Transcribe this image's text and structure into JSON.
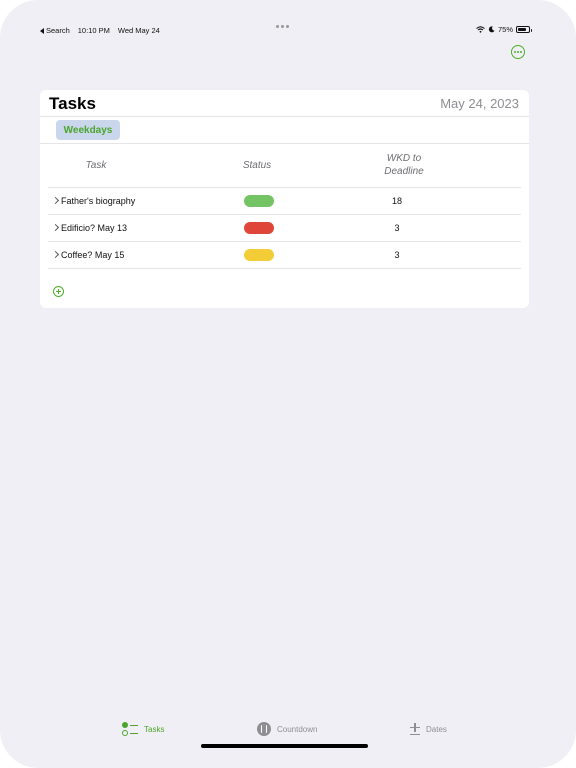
{
  "status_bar": {
    "back_label": "Search",
    "time": "10:10 PM",
    "date": "Wed May 24",
    "battery": "75%",
    "battery_level": 0.75
  },
  "card": {
    "title": "Tasks",
    "date": "May 24, 2023",
    "segment_label": "Weekdays",
    "columns": {
      "task": "Task",
      "status": "Status",
      "wkd_line1": "WKD to",
      "wkd_line2": "Deadline"
    },
    "rows": [
      {
        "name": "Father's biography",
        "status_color": "#74c365",
        "days": "18"
      },
      {
        "name": "Edificio? May 13",
        "status_color": "#e0453a",
        "days": "3"
      },
      {
        "name": "Coffee? May 15",
        "status_color": "#f2cd37",
        "days": "3"
      }
    ]
  },
  "tab_bar": {
    "tabs": [
      {
        "label": "Tasks",
        "icon": "tasks-checklist-icon",
        "selected": true
      },
      {
        "label": "Countdown",
        "icon": "countdown-timer-icon",
        "selected": false
      },
      {
        "label": "Dates",
        "icon": "plus-minus-icon",
        "selected": false
      }
    ]
  },
  "colors": {
    "accent": "#4ba52b",
    "background": "#f0eff5",
    "segment_bg": "#c9d6ec"
  }
}
